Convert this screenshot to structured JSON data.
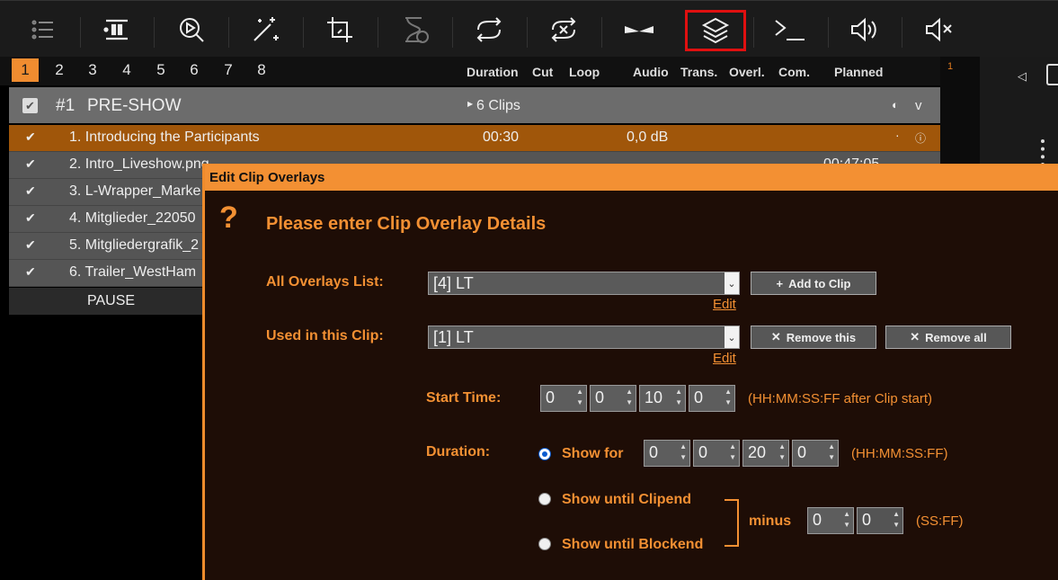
{
  "toolbar": {
    "icons": [
      "list-icon",
      "pause-icon",
      "search-play-icon",
      "magic-wand-icon",
      "crop-icon",
      "hourglass-icon",
      "loop-icon",
      "shuffle-cancel-icon",
      "transition-icon",
      "layers-icon",
      "terminal-icon",
      "volume-icon",
      "mute-icon"
    ]
  },
  "tabs": [
    "1",
    "2",
    "3",
    "4",
    "5",
    "6",
    "7",
    "8"
  ],
  "columns": {
    "duration": "Duration",
    "cut": "Cut",
    "loop": "Loop",
    "audio": "Audio",
    "trans": "Trans.",
    "overl": "Overl.",
    "com": "Com.",
    "planned": "Planned"
  },
  "right_number": "1",
  "block": {
    "number": "#1",
    "name": "PRE-SHOW",
    "clips": "6 Clips"
  },
  "rows": [
    {
      "label": "1. Introducing the Participants",
      "duration": "00:30",
      "audio": "0,0 dB"
    },
    {
      "label": "2. Intro_Liveshow.png",
      "planned": "00:47:05"
    },
    {
      "label": "3. L-Wrapper_Marke"
    },
    {
      "label": "4. Mitglieder_22050"
    },
    {
      "label": "5. Mitgliedergrafik_2"
    },
    {
      "label": "6. Trailer_WestHam"
    }
  ],
  "pause_label": "PAUSE",
  "dialog": {
    "title": "Edit Clip Overlays",
    "heading": "Please enter Clip Overlay Details",
    "all_overlays_label": "All Overlays List:",
    "all_overlays_value": "[4] LT",
    "add_button": "Add to Clip",
    "edit_link": "Edit",
    "used_label": "Used in this Clip:",
    "used_value": "[1] LT",
    "remove_this": "Remove this",
    "remove_all": "Remove all",
    "start_time_label": "Start Time:",
    "start_time": [
      "0",
      "0",
      "10",
      "0"
    ],
    "start_hint": "(HH:MM:SS:FF after Clip start)",
    "duration_label": "Duration:",
    "show_for": "Show for",
    "duration": [
      "0",
      "0",
      "20",
      "0"
    ],
    "duration_hint": "(HH:MM:SS:FF)",
    "show_until_clipend": "Show until Clipend",
    "show_until_blockend": "Show until Blockend",
    "minus": "minus",
    "minus_values": [
      "0",
      "0"
    ],
    "minus_hint": "(SS:FF)"
  },
  "colors": {
    "accent": "#f39033",
    "selected_row": "#a0560a",
    "highlight_box": "#e01010"
  }
}
